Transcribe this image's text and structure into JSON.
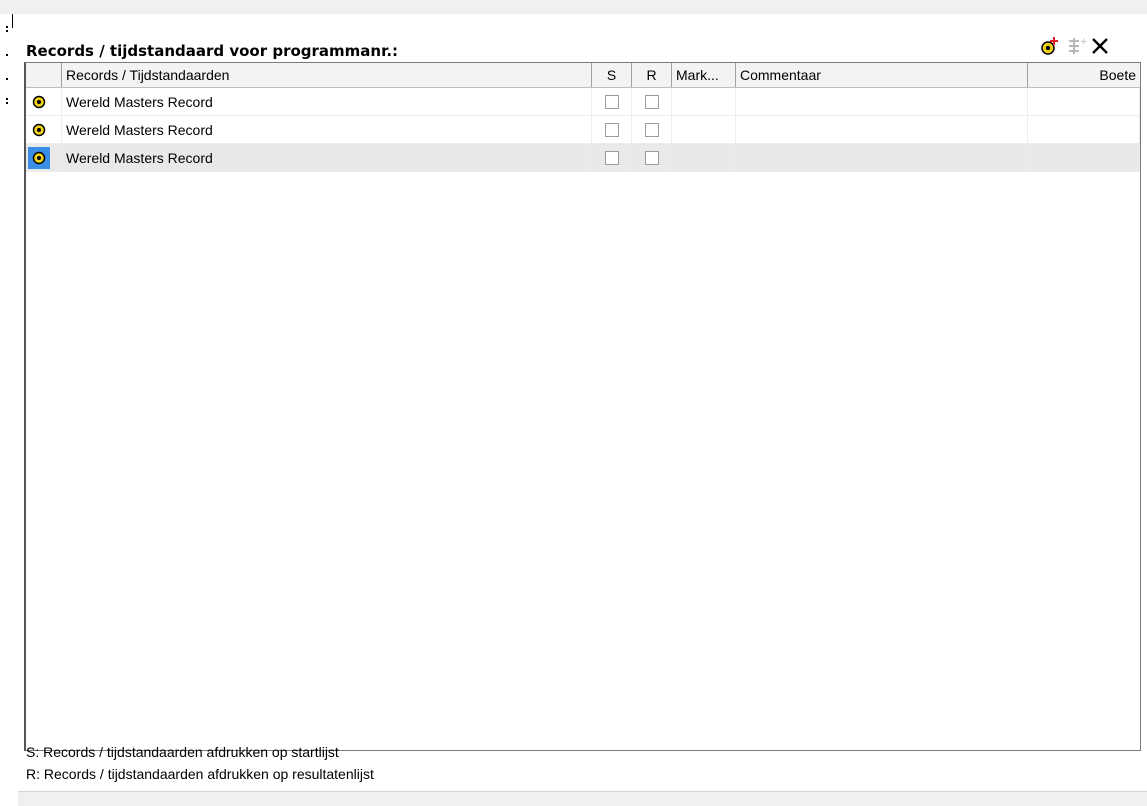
{
  "panel": {
    "title": "Records / tijdstandaard voor programmanr.:"
  },
  "toolbar": {
    "add_icon": "add-record-icon",
    "move_icon": "move-record-icon",
    "close_icon": "close-icon",
    "colors": {
      "add_plus": "#e02020",
      "add_dot": "#f2d21a"
    }
  },
  "table": {
    "columns": {
      "name": "Records / Tijdstandaarden",
      "s": "S",
      "r": "R",
      "mark": "Mark...",
      "comment": "Commentaar",
      "boete": "Boete"
    },
    "rows": [
      {
        "icon": "record-icon",
        "name": "Wereld Masters Record",
        "s": false,
        "r": false,
        "mark": "",
        "comment": "",
        "boete": "",
        "selected": false
      },
      {
        "icon": "record-icon",
        "name": "Wereld Masters Record",
        "s": false,
        "r": false,
        "mark": "",
        "comment": "",
        "boete": "",
        "selected": false
      },
      {
        "icon": "record-icon",
        "name": "Wereld Masters Record",
        "s": false,
        "r": false,
        "mark": "",
        "comment": "",
        "boete": "",
        "selected": true
      }
    ]
  },
  "legend": {
    "line1": "S: Records / tijdstandaarden afdrukken op startlijst",
    "line2": "R: Records / tijdstandaarden afdrukken op resultatenlijst"
  },
  "colors": {
    "selected_row": "#e9e9e9",
    "selected_icon_bg": "#3a8ee6",
    "record_icon": "#f2d21a"
  }
}
